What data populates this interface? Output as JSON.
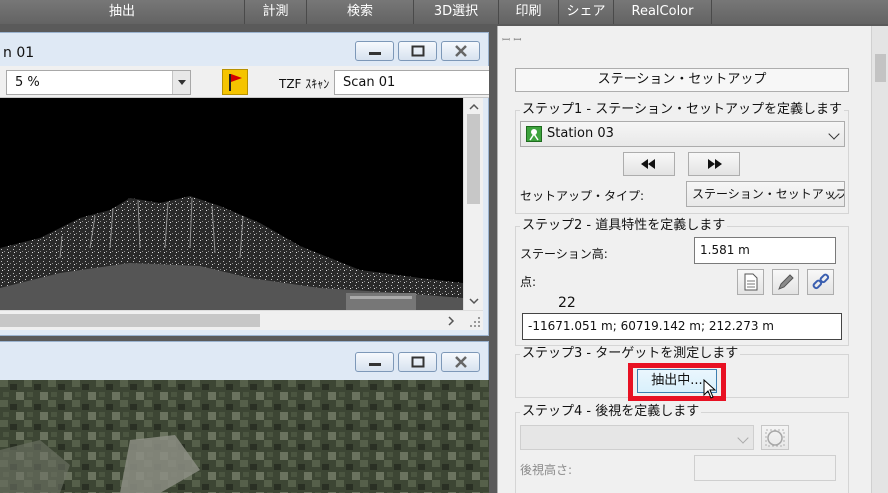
{
  "menu": [
    "抽出",
    "計測",
    "検索",
    "3D選択",
    "印刷",
    "シェア",
    "RealColor"
  ],
  "scan_window": {
    "title": "n 01",
    "zoom_value": "5 %",
    "tzf_label": "TZF ｽｷｬﾝ",
    "scan_name": "Scan 01"
  },
  "panel": {
    "pin_glyph": "ꟷ ꟷ",
    "header": "ステーション・セットアップ",
    "step1": {
      "title": "ステップ1 - ステーション・セットアップを定義します",
      "station": "Station 03",
      "setup_type_label": "セットアップ・タイプ:",
      "setup_type_value": "ステーション・セットアップ"
    },
    "step2": {
      "title": "ステップ2 - 道具特性を定義します",
      "height_label": "ステーション高:",
      "height_value": "1.581 m",
      "point_label": "点:",
      "point_number": "22",
      "coords": "-11671.051 m; 60719.142 m; 212.273 m"
    },
    "step3": {
      "title": "ステップ3 - ターゲットを測定します",
      "extract_button": "抽出中..."
    },
    "step4": {
      "title": "ステップ4 - 後視を定義します",
      "backsight_height_label": "後視高さ:"
    }
  },
  "colors": {
    "highlight": "#e81123",
    "flag_bg": "#f5c400",
    "station_icon": "#3da33d"
  }
}
